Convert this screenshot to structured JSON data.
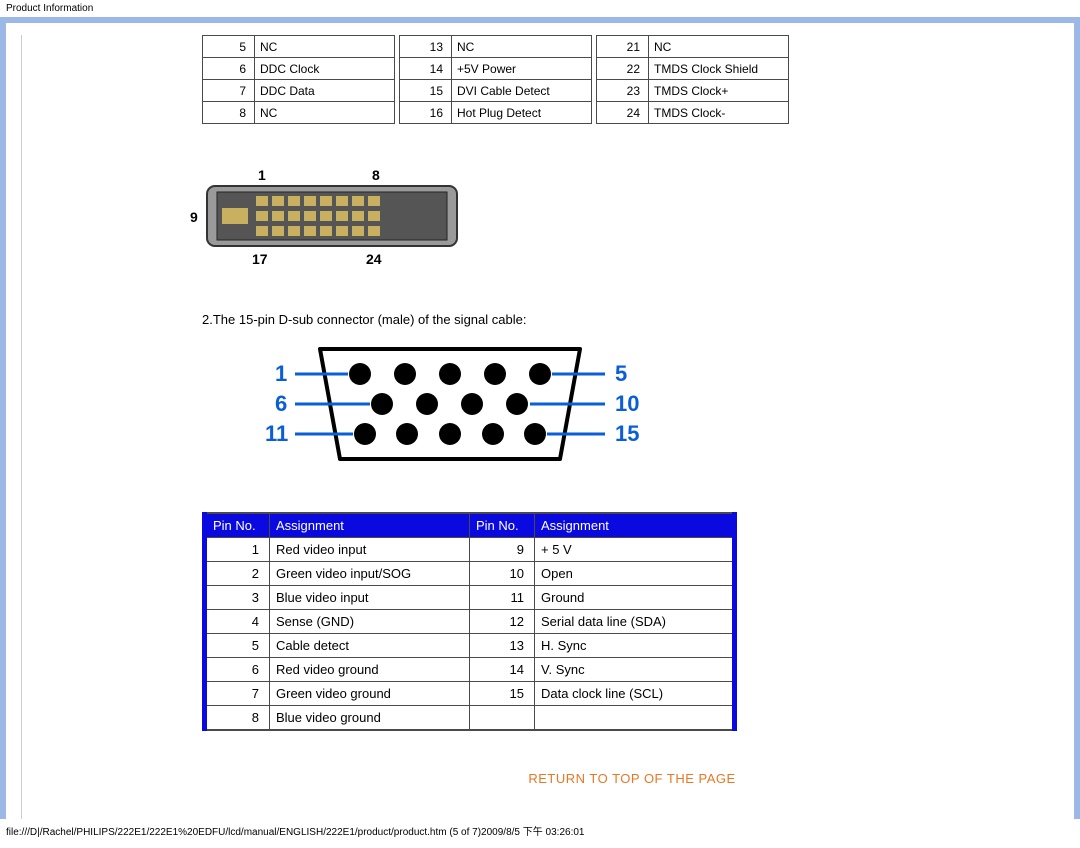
{
  "header": {
    "title": "Product Information"
  },
  "dvi_table": {
    "col1": [
      {
        "pin": "5",
        "label": "NC"
      },
      {
        "pin": "6",
        "label": "DDC Clock"
      },
      {
        "pin": "7",
        "label": "DDC Data"
      },
      {
        "pin": "8",
        "label": "NC"
      }
    ],
    "col2": [
      {
        "pin": "13",
        "label": "NC"
      },
      {
        "pin": "14",
        "label": "+5V Power"
      },
      {
        "pin": "15",
        "label": "DVI Cable Detect"
      },
      {
        "pin": "16",
        "label": "Hot Plug Detect"
      }
    ],
    "col3": [
      {
        "pin": "21",
        "label": "NC"
      },
      {
        "pin": "22",
        "label": "TMDS Clock Shield"
      },
      {
        "pin": "23",
        "label": "TMDS Clock+"
      },
      {
        "pin": "24",
        "label": "TMDS Clock-"
      }
    ]
  },
  "dvi_diagram": {
    "label_tl": "1",
    "label_tr": "8",
    "label_left": "9",
    "label_bl": "17",
    "label_br": "24"
  },
  "dsub_desc": "2.The 15-pin D-sub connector (male) of the signal cable:",
  "dsub_diagram": {
    "r1l": "1",
    "r1r": "5",
    "r2l": "6",
    "r2r": "10",
    "r3l": "11",
    "r3r": "15"
  },
  "dsub_table": {
    "headers": {
      "pin": "Pin No.",
      "assign": "Assignment"
    },
    "left": [
      {
        "pin": "1",
        "label": "Red video input"
      },
      {
        "pin": "2",
        "label": "Green video input/SOG"
      },
      {
        "pin": "3",
        "label": "Blue video input"
      },
      {
        "pin": "4",
        "label": "Sense (GND)"
      },
      {
        "pin": "5",
        "label": "Cable detect"
      },
      {
        "pin": "6",
        "label": "Red video ground"
      },
      {
        "pin": "7",
        "label": "Green video ground"
      },
      {
        "pin": "8",
        "label": "Blue video ground"
      }
    ],
    "right": [
      {
        "pin": "9",
        "label": "+ 5 V"
      },
      {
        "pin": "10",
        "label": "Open"
      },
      {
        "pin": "11",
        "label": "Ground"
      },
      {
        "pin": "12",
        "label": "Serial data line (SDA)"
      },
      {
        "pin": "13",
        "label": "H. Sync"
      },
      {
        "pin": "14",
        "label": "V. Sync"
      },
      {
        "pin": "15",
        "label": "Data clock line (SCL)"
      },
      {
        "pin": "",
        "label": ""
      }
    ]
  },
  "return_link": "RETURN TO TOP OF THE PAGE",
  "footer": "file:///D|/Rachel/PHILIPS/222E1/222E1%20EDFU/lcd/manual/ENGLISH/222E1/product/product.htm (5 of 7)2009/8/5 下午 03:26:01"
}
